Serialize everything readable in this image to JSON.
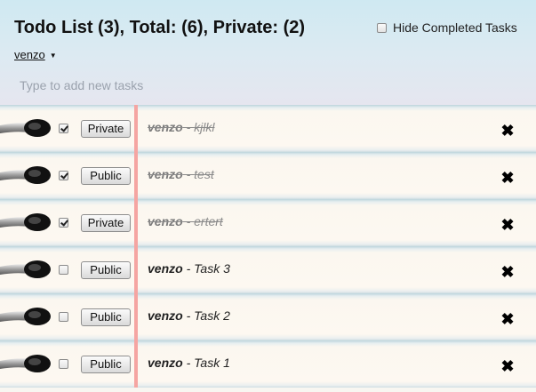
{
  "header": {
    "title": "Todo List (3), Total: (6), Private: (2)",
    "hide_completed": {
      "label": "Hide Completed Tasks",
      "checked": false
    },
    "user": {
      "name": "venzo",
      "caret": "▼"
    }
  },
  "new_task": {
    "placeholder": "Type to add new tasks",
    "value": ""
  },
  "tasks": [
    {
      "checked": true,
      "privacy": "Private",
      "owner": "venzo",
      "separator": " - ",
      "text": "kjlkl",
      "delete": "✖"
    },
    {
      "checked": true,
      "privacy": "Public",
      "owner": "venzo",
      "separator": " - ",
      "text": "test",
      "delete": "✖"
    },
    {
      "checked": true,
      "privacy": "Private",
      "owner": "venzo",
      "separator": " - ",
      "text": "ertert",
      "delete": "✖"
    },
    {
      "checked": false,
      "privacy": "Public",
      "owner": "venzo",
      "separator": " - ",
      "text": "Task 3",
      "delete": "✖"
    },
    {
      "checked": false,
      "privacy": "Public",
      "owner": "venzo",
      "separator": " - ",
      "text": "Task 2",
      "delete": "✖"
    },
    {
      "checked": false,
      "privacy": "Public",
      "owner": "venzo",
      "separator": " - ",
      "text": "Task 1",
      "delete": "✖"
    }
  ],
  "colors": {
    "margin_line": "#f5a5a2",
    "row_paper": "#fdf8f1",
    "header_top": "#cfe9f2",
    "completed_text": "#8a8a8a"
  },
  "icons": {
    "binder_ring": "binder-ring-icon",
    "delete": "close-x-icon",
    "checkbox": "checkbox-icon"
  }
}
